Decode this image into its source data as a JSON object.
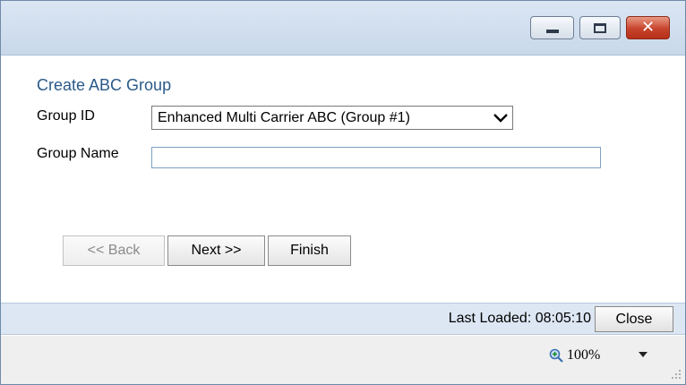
{
  "window": {
    "controls": {
      "minimize_icon": "minimize-icon",
      "maximize_icon": "maximize-icon",
      "close_icon": "close-icon",
      "close_glyph": "✕",
      "close_color": "#c8432c"
    }
  },
  "form": {
    "title": "Create ABC Group",
    "group_id": {
      "label": "Group ID",
      "selected": "Enhanced Multi Carrier ABC (Group #1)"
    },
    "group_name": {
      "label": "Group Name",
      "value": "",
      "placeholder": ""
    }
  },
  "buttons": {
    "back": "<< Back",
    "next": "Next >>",
    "finish": "Finish"
  },
  "status": {
    "last_loaded": "Last Loaded: 08:05:10",
    "close": "Close"
  },
  "zoom": {
    "level": "100%",
    "icon": "zoom-icon"
  },
  "colors": {
    "title_text": "#2a5a8a",
    "titlebar": "#c8d8ea",
    "statusbar": "#dde7f3"
  }
}
